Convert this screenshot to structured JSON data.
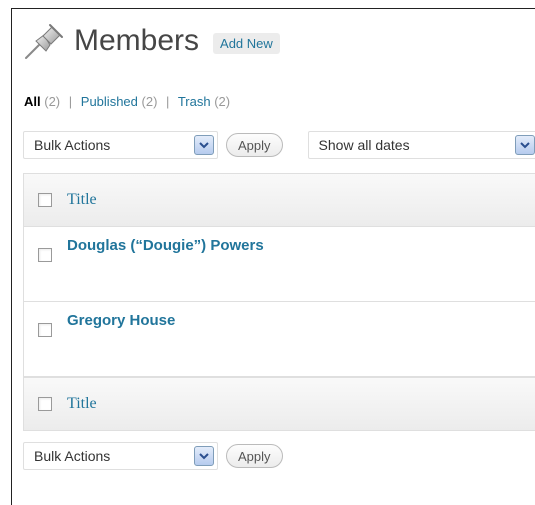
{
  "header": {
    "title": "Members",
    "add_new_label": "Add New",
    "icon": "pushpin-icon"
  },
  "views": {
    "all": {
      "label": "All",
      "count": "(2)"
    },
    "published": {
      "label": "Published",
      "count": "(2)"
    },
    "trash": {
      "label": "Trash",
      "count": "(2)"
    },
    "separator": "|"
  },
  "tablenav_top": {
    "bulk_actions": "Bulk Actions",
    "apply": "Apply",
    "date_filter": "Show all dates"
  },
  "table": {
    "column_title": "Title",
    "rows": [
      {
        "title": "Douglas (“Dougie”) Powers"
      },
      {
        "title": "Gregory House"
      }
    ]
  },
  "tablenav_bottom": {
    "bulk_actions": "Bulk Actions",
    "apply": "Apply"
  },
  "colors": {
    "link": "#21759b",
    "title_text": "#464646",
    "border": "#dfdfdf"
  }
}
